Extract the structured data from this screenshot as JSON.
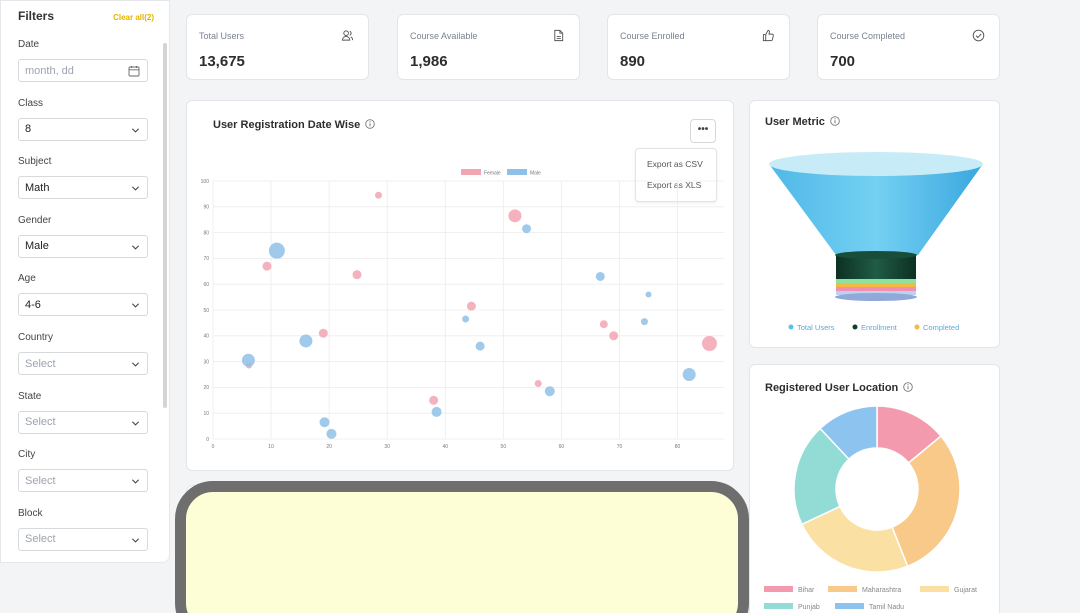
{
  "filters": {
    "title": "Filters",
    "clear_label": "Clear all(2)",
    "fields": [
      {
        "label": "Date",
        "value": "month, dd",
        "is_placeholder": true,
        "control": "date"
      },
      {
        "label": "Class",
        "value": "8",
        "is_placeholder": false,
        "control": "select"
      },
      {
        "label": "Subject",
        "value": "Math",
        "is_placeholder": false,
        "control": "select"
      },
      {
        "label": "Gender",
        "value": "Male",
        "is_placeholder": false,
        "control": "select"
      },
      {
        "label": "Age",
        "value": "4-6",
        "is_placeholder": false,
        "control": "select"
      },
      {
        "label": "Country",
        "value": "Select",
        "is_placeholder": true,
        "control": "select"
      },
      {
        "label": "State",
        "value": "Select",
        "is_placeholder": true,
        "control": "select"
      },
      {
        "label": "City",
        "value": "Select",
        "is_placeholder": true,
        "control": "select"
      },
      {
        "label": "Block",
        "value": "Select",
        "is_placeholder": true,
        "control": "select"
      }
    ]
  },
  "stats": [
    {
      "label": "Total Users",
      "value": "13,675",
      "icon": "users-icon"
    },
    {
      "label": "Course Available",
      "value": "1,986",
      "icon": "document-icon"
    },
    {
      "label": "Course Enrolled",
      "value": "890",
      "icon": "thumbs-up-icon"
    },
    {
      "label": "Course Completed",
      "value": "700",
      "icon": "check-circle-icon"
    }
  ],
  "registration": {
    "title": "User Registration Date Wise",
    "menu_button": "•••",
    "menu": [
      "Export as CSV",
      "Export as XLS"
    ]
  },
  "chart_data": {
    "type": "scatter",
    "title": "User Registration Date Wise",
    "legend": [
      "Female",
      "Male"
    ],
    "legend_position": "top",
    "grid": true,
    "xlim": [
      0,
      88
    ],
    "ylim": [
      0,
      100
    ],
    "x_ticks": [
      0,
      10,
      20,
      30,
      40,
      50,
      60,
      70,
      80
    ],
    "y_ticks": [
      0,
      10,
      20,
      30,
      40,
      50,
      60,
      70,
      80,
      90,
      100
    ],
    "series": [
      {
        "name": "Female",
        "color": "#f2a5b3",
        "points": [
          {
            "x": 6.2,
            "y": 28.5,
            "r": 3
          },
          {
            "x": 9.3,
            "y": 67,
            "r": 4.5
          },
          {
            "x": 19,
            "y": 41,
            "r": 4.5
          },
          {
            "x": 24.8,
            "y": 63.7,
            "r": 4.5
          },
          {
            "x": 28.5,
            "y": 94.5,
            "r": 3.5
          },
          {
            "x": 38,
            "y": 15,
            "r": 4.5
          },
          {
            "x": 44.5,
            "y": 51.5,
            "r": 4.5
          },
          {
            "x": 52,
            "y": 86.5,
            "r": 6.5
          },
          {
            "x": 56,
            "y": 21.5,
            "r": 3.5
          },
          {
            "x": 67.3,
            "y": 44.5,
            "r": 4
          },
          {
            "x": 69,
            "y": 40,
            "r": 4.5
          },
          {
            "x": 85.5,
            "y": 37,
            "r": 7.5
          }
        ]
      },
      {
        "name": "Male",
        "color": "#8fc1e8",
        "points": [
          {
            "x": 6.1,
            "y": 30.5,
            "r": 6.5
          },
          {
            "x": 11,
            "y": 73,
            "r": 8
          },
          {
            "x": 16,
            "y": 38,
            "r": 6.5
          },
          {
            "x": 19.2,
            "y": 6.5,
            "r": 5
          },
          {
            "x": 20.4,
            "y": 2,
            "r": 5
          },
          {
            "x": 38.5,
            "y": 10.5,
            "r": 5
          },
          {
            "x": 43.5,
            "y": 46.5,
            "r": 3.5
          },
          {
            "x": 46,
            "y": 36,
            "r": 4.5
          },
          {
            "x": 54,
            "y": 81.5,
            "r": 4.5
          },
          {
            "x": 58,
            "y": 18.5,
            "r": 5
          },
          {
            "x": 66.7,
            "y": 63,
            "r": 4.5
          },
          {
            "x": 74.3,
            "y": 45.5,
            "r": 3.5
          },
          {
            "x": 75,
            "y": 56,
            "r": 3
          },
          {
            "x": 82,
            "y": 25,
            "r": 6.5
          }
        ]
      }
    ]
  },
  "user_metric": {
    "title": "User Metric",
    "legend": [
      {
        "label": "Total Users",
        "color": "#59c1ea"
      },
      {
        "label": "Enrollment",
        "color": "#0f3d2e"
      },
      {
        "label": "Completed",
        "color": "#f4b844"
      }
    ]
  },
  "location": {
    "title": "Registered User Location",
    "slices": [
      {
        "label": "Bihar",
        "value": 14,
        "color": "#f49aae"
      },
      {
        "label": "Maharashtra",
        "value": 30,
        "color": "#f9c98a"
      },
      {
        "label": "Gujarat",
        "value": 24,
        "color": "#fbe0a3"
      },
      {
        "label": "Punjab",
        "value": 20,
        "color": "#93dcd6"
      },
      {
        "label": "Tamil Nadu",
        "value": 12,
        "color": "#8cc3ef"
      }
    ]
  }
}
